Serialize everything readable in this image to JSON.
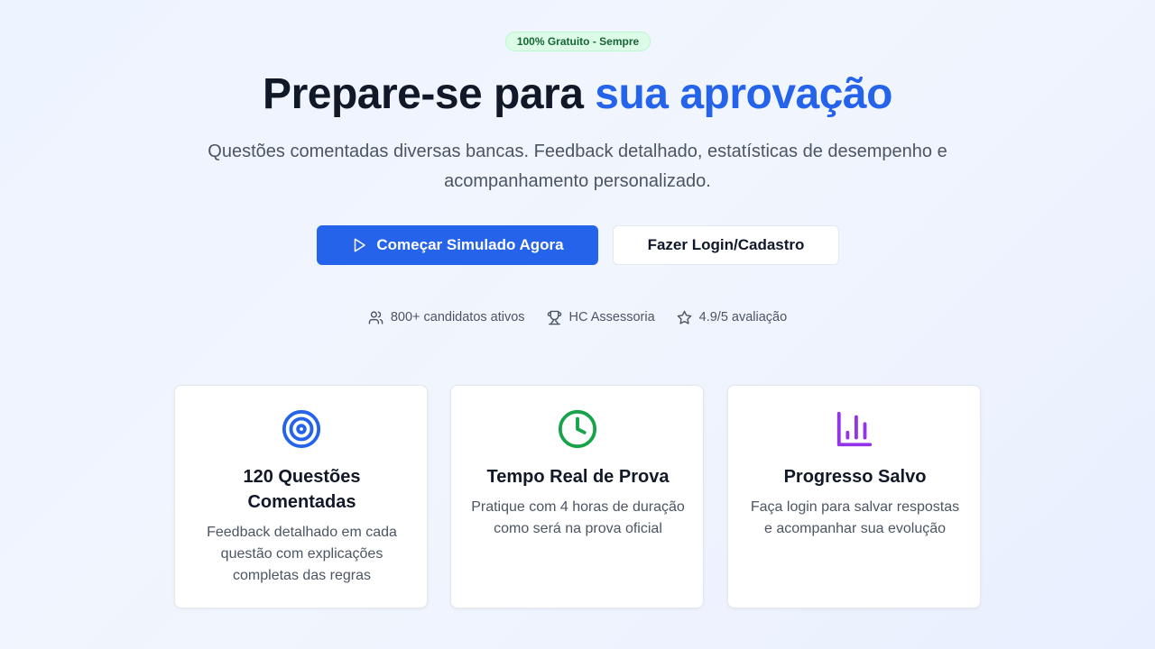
{
  "hero": {
    "badge": "100% Gratuito - Sempre",
    "title_main": "Prepare-se para ",
    "title_accent": "sua aprovação",
    "subtitle": "Questões comentadas diversas bancas. Feedback detalhado, estatísticas de desempenho e acompanhamento personalizado.",
    "primary_button": "Começar Simulado Agora",
    "secondary_button": "Fazer Login/Cadastro"
  },
  "stats": [
    {
      "icon": "users-icon",
      "label": "800+ candidatos ativos"
    },
    {
      "icon": "trophy-icon",
      "label": "HC Assessoria"
    },
    {
      "icon": "star-icon",
      "label": "4.9/5 avaliação"
    }
  ],
  "features": [
    {
      "icon": "target-icon",
      "icon_color": "#2563eb",
      "title": "120 Questões Comentadas",
      "description": "Feedback detalhado em cada questão com explicações completas das regras"
    },
    {
      "icon": "clock-icon",
      "icon_color": "#16a34a",
      "title": "Tempo Real de Prova",
      "description": "Pratique com 4 horas de duração como será na prova oficial"
    },
    {
      "icon": "bar-chart-icon",
      "icon_color": "#9333ea",
      "title": "Progresso Salvo",
      "description": "Faça login para salvar respostas e acompanhar sua evolução"
    }
  ],
  "colors": {
    "accent": "#2563eb",
    "badge_bg": "#dcfce7",
    "badge_text": "#166534"
  }
}
